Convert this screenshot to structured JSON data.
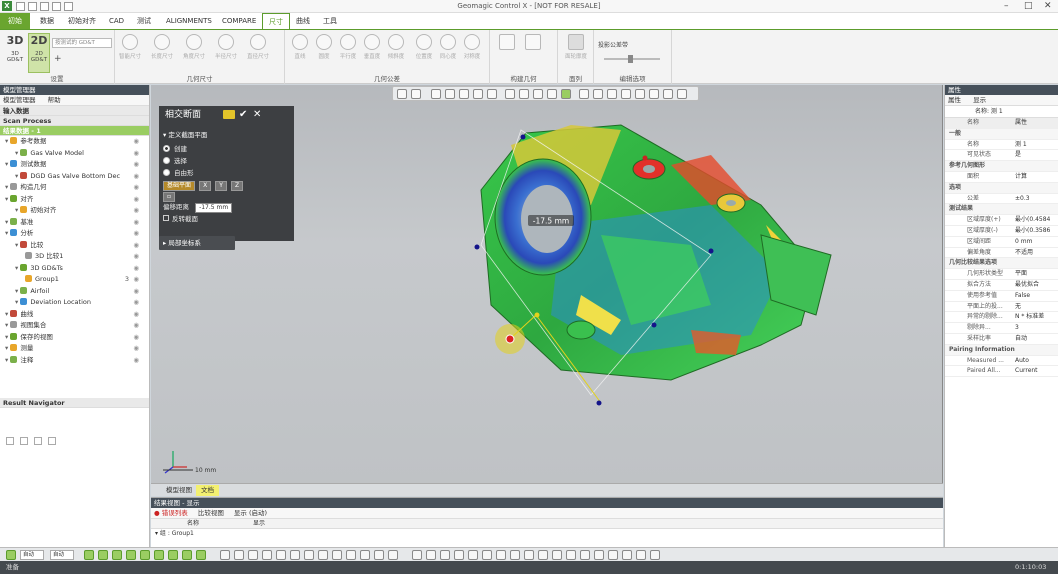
{
  "app": {
    "title": "Geomagic Control X - [NOT FOR RESALE]",
    "logo": "X"
  },
  "menu": {
    "tabs": [
      "初始",
      "数据",
      "初始对齐",
      "CAD",
      "测试",
      "ALIGNMENTS",
      "COMPARE",
      "尺寸",
      "曲线",
      "工具"
    ],
    "active_index": 7
  },
  "ribbon": {
    "gdt": {
      "btn3d": "3D",
      "btn3d_sub": "3D GD&T",
      "btn2d": "2D",
      "btn2d_sub": "2D GD&T",
      "dropdown": "按测试的 GD&T"
    },
    "groups": {
      "g1": "设置",
      "g2": "几何尺寸",
      "g3": "几何公差",
      "g4": "构建几何",
      "g5": "面列",
      "g6": "编辑选项"
    },
    "dims": [
      "智能尺寸",
      "长度尺寸",
      "角度尺寸",
      "半径尺寸",
      "直径尺寸"
    ],
    "tols": [
      "直线",
      "圆度",
      "平行度",
      "垂直度",
      "倾斜度",
      "位置度",
      "同心度",
      "对称度"
    ],
    "misc": {
      "surface_profile": "面轮廓度",
      "slider_label": "投影公差带"
    }
  },
  "left_panel": {
    "header": "模型管理器",
    "tab1": "模型管理器",
    "tab2": "帮助",
    "sec_input": "输入数据",
    "sec_scan": "Scan Process",
    "sec_active": "结果数据 - 1",
    "tree": [
      {
        "label": "参考数据",
        "depth": 0
      },
      {
        "label": "Gas Valve Model",
        "depth": 1
      },
      {
        "label": "测试数据",
        "depth": 0
      },
      {
        "label": "DGD Gas Valve Bottom Dec",
        "depth": 1
      },
      {
        "label": "构造几何",
        "depth": 0
      },
      {
        "label": "对齐",
        "depth": 0
      },
      {
        "label": "初始对齐",
        "depth": 1
      },
      {
        "label": "基准",
        "depth": 0
      },
      {
        "label": "分析",
        "depth": 0
      },
      {
        "label": "比较",
        "depth": 1
      },
      {
        "label": "3D 比较1",
        "depth": 2
      },
      {
        "label": "3D GD&Ts",
        "depth": 1
      },
      {
        "label": "Group1",
        "depth": 2,
        "badge": "3"
      },
      {
        "label": "Airfoil",
        "depth": 1
      },
      {
        "label": "Deviation Location",
        "depth": 1
      },
      {
        "label": "曲线",
        "depth": 0
      },
      {
        "label": "视图集合",
        "depth": 0
      },
      {
        "label": "保存的视图",
        "depth": 0
      },
      {
        "label": "测量",
        "depth": 0
      },
      {
        "label": "注释",
        "depth": 0
      }
    ],
    "sec_result_nav": "Result Navigator"
  },
  "cross_section": {
    "title": "相交断面",
    "sec_plane": "定义截面平面",
    "options": [
      "创建",
      "选择",
      "自由形"
    ],
    "plane_btn": "基础平面",
    "axes": [
      "X",
      "Y",
      "Z"
    ],
    "offset_label": "偏移距离",
    "offset_value": "-17.5 mm",
    "check_label": "反转截面",
    "local_cs": "局部坐标系"
  },
  "viewport": {
    "measure_label": "-17.5 mm",
    "scale_label": "10 mm"
  },
  "view_tabs": {
    "tab1": "模型视图",
    "tab2": "文档"
  },
  "result_panel": {
    "header": "结果视图 - 显示",
    "tab1": "错误列表",
    "tab2": "比较视图",
    "tab3": "显示 (启动)",
    "col1": "名称",
    "col2": "显示",
    "row1": "组 : Group1"
  },
  "right_panel": {
    "header": "属性",
    "tab1": "属性",
    "tab2": "显示",
    "name_label": "名称: 测 1",
    "col_name": "名称",
    "col_value": "属性",
    "rows": [
      {
        "k": "一般",
        "grp": true
      },
      {
        "k": "名称",
        "v": "测 1"
      },
      {
        "k": "可见状态",
        "v": "是"
      },
      {
        "k": "参考几何图形",
        "grp": true
      },
      {
        "k": "面积",
        "v": "计算"
      },
      {
        "k": "选项",
        "grp": true
      },
      {
        "k": "公差",
        "v": "±0.3"
      },
      {
        "k": "测试结果",
        "grp": true
      },
      {
        "k": "区域厚度(+)",
        "v": "最小(0.4584"
      },
      {
        "k": "区域厚度(-)",
        "v": "最小(0.3586"
      },
      {
        "k": "区域间距",
        "v": "0 mm"
      },
      {
        "k": "偏差角度",
        "v": "不适用"
      },
      {
        "k": "几何比较结果选项",
        "grp": true
      },
      {
        "k": "几何形状类型",
        "v": "平面"
      },
      {
        "k": "拟合方法",
        "v": "最优拟合"
      },
      {
        "k": "使用参考值",
        "v": "False"
      },
      {
        "k": "平面上的投...",
        "v": "无"
      },
      {
        "k": "异常的剔除...",
        "v": "N * 标准差"
      },
      {
        "k": "剔除异...",
        "v": "3"
      },
      {
        "k": "采样比率",
        "v": "自动"
      },
      {
        "k": "Pairing Information",
        "grp": true
      },
      {
        "k": "Measured ...",
        "v": "Auto"
      },
      {
        "k": "Paired All...",
        "v": "Current"
      }
    ]
  },
  "status": {
    "left": "准备",
    "right": "0:1:10:03",
    "combo1": "自动",
    "combo2": "自动"
  },
  "colors": {
    "accent": "#5c9c2c",
    "file_tab": "#6aa52f"
  }
}
